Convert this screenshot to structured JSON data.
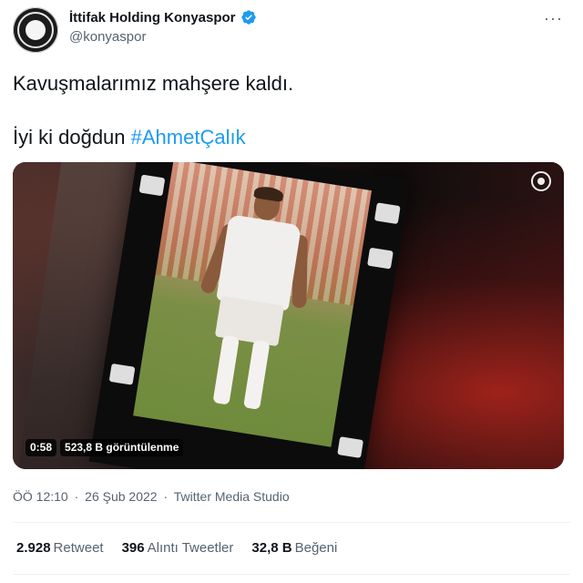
{
  "author": {
    "name": "İttifak Holding Konyaspor",
    "handle": "@konyaspor",
    "verified_icon": "verified-badge-icon",
    "verified_color": "#1d9bf0"
  },
  "more_menu": {
    "label": "···"
  },
  "tweet": {
    "line1": "Kavuşmalarımız mahşere kaldı.",
    "line2_prefix": "İyi ki doğdun ",
    "hashtag": "#AhmetÇalık"
  },
  "media": {
    "duration": "0:58",
    "views": "523,8 B görüntülenme"
  },
  "meta": {
    "time": "ÖÖ 12:10",
    "separator1": "·",
    "date": "26 Şub 2022",
    "separator2": "·",
    "source": "Twitter Media Studio"
  },
  "stats": [
    {
      "value": "2.928",
      "label": "Retweet"
    },
    {
      "value": "396",
      "label": "Alıntı Tweetler"
    },
    {
      "value": "32,8 B",
      "label": "Beğeni"
    }
  ],
  "colors": {
    "text": "#0f1419",
    "secondary": "#536471",
    "accent": "#1d9bf0"
  }
}
